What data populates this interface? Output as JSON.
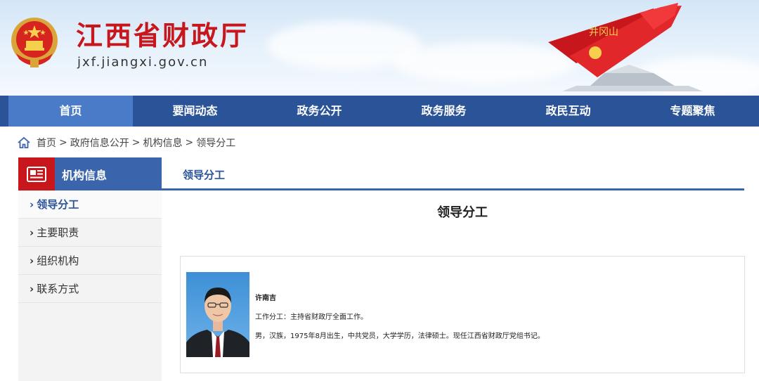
{
  "header": {
    "title": "江西省财政厅",
    "url": "jxf.jiangxi.gov.cn",
    "monument_text": "井冈山"
  },
  "nav": {
    "items": [
      "首页",
      "要闻动态",
      "政务公开",
      "政务服务",
      "政民互动",
      "专题聚焦"
    ]
  },
  "breadcrumb": {
    "items": [
      "首页",
      "政府信息公开",
      "机构信息",
      "领导分工"
    ],
    "separator": ">"
  },
  "sidebar": {
    "title": "机构信息",
    "arrow": "›",
    "items": [
      "领导分工",
      "主要职责",
      "组织机构",
      "联系方式"
    ]
  },
  "main": {
    "tab_label": "领导分工",
    "heading": "领导分工",
    "leader": {
      "name": "许南吉",
      "duty": "工作分工：主持省财政厅全面工作。",
      "bio": "男，汉族，1975年8月出生，中共党员，大学学历，法律硕士。现任江西省财政厅党组书记。"
    }
  },
  "colors": {
    "nav_bg": "#2b5398",
    "nav_active": "#4a7bc8",
    "title_red": "#c8161d",
    "accent_blue": "#3a64ab"
  }
}
